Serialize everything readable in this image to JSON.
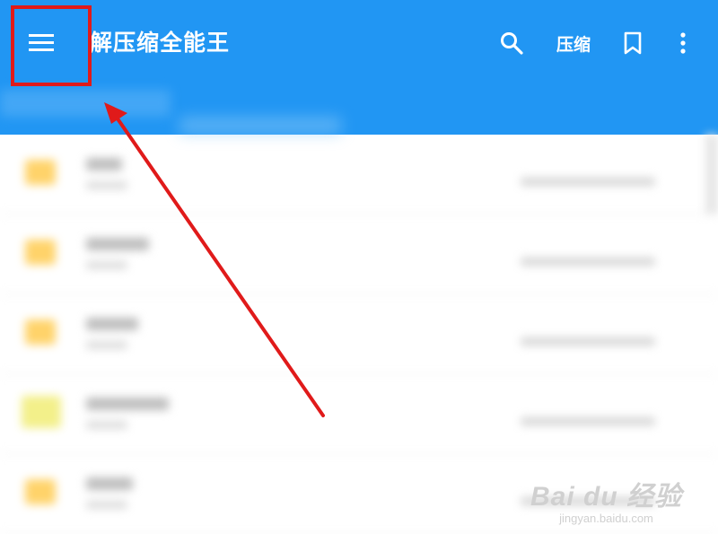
{
  "appbar": {
    "title": "解压缩全能王",
    "compress_label": "压缩",
    "icons": [
      "menu-icon",
      "search-icon",
      "bookmark-icon",
      "more-vert-icon"
    ],
    "color": "#2196f3"
  },
  "annotation": {
    "box_color": "#e01a1a",
    "arrow_color": "#e01a1a"
  },
  "file_list": {
    "rows": [
      {
        "icon": "folder-icon"
      },
      {
        "icon": "folder-icon"
      },
      {
        "icon": "folder-icon"
      },
      {
        "icon": "folder-icon"
      },
      {
        "icon": "folder-icon"
      }
    ]
  },
  "watermark": {
    "main": "Bai du 经验",
    "sub": "jingyan.baidu.com"
  }
}
